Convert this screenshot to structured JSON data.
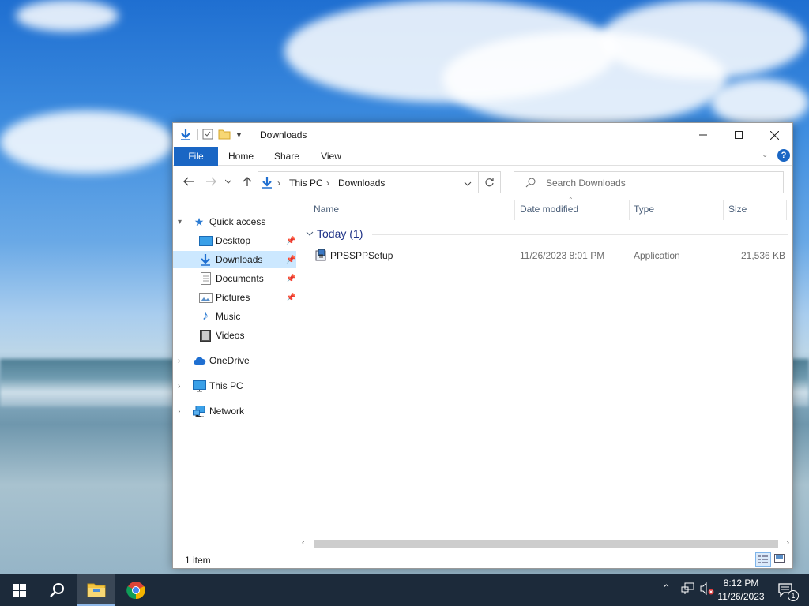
{
  "window": {
    "title": "Downloads",
    "controls": {
      "minimize": "—",
      "maximize": "☐",
      "close": "✕"
    }
  },
  "ribbon": {
    "tabs": [
      {
        "label": "File"
      },
      {
        "label": "Home"
      },
      {
        "label": "Share"
      },
      {
        "label": "View"
      }
    ],
    "help": "?"
  },
  "address": {
    "crumbs": [
      "This PC",
      "Downloads"
    ],
    "search_placeholder": "Search Downloads"
  },
  "nav": {
    "quick_access": "Quick access",
    "items": [
      {
        "label": "Desktop",
        "pinned": true
      },
      {
        "label": "Downloads",
        "pinned": true,
        "selected": true
      },
      {
        "label": "Documents",
        "pinned": true
      },
      {
        "label": "Pictures",
        "pinned": true
      },
      {
        "label": "Music",
        "pinned": false
      },
      {
        "label": "Videos",
        "pinned": false
      }
    ],
    "onedrive": "OneDrive",
    "thispc": "This PC",
    "network": "Network"
  },
  "columns": {
    "name": "Name",
    "date": "Date modified",
    "type": "Type",
    "size": "Size"
  },
  "group": {
    "label": "Today (1)"
  },
  "files": [
    {
      "name": "PPSSPPSetup",
      "date": "11/26/2023 8:01 PM",
      "type": "Application",
      "size": "21,536 KB"
    }
  ],
  "status": {
    "count": "1 item"
  },
  "taskbar": {
    "time": "8:12 PM",
    "date": "11/26/2023",
    "notification_count": "1"
  },
  "colors": {
    "accent": "#1a66c4",
    "selection": "#cce8ff",
    "taskbar": "#1c2a3a"
  }
}
